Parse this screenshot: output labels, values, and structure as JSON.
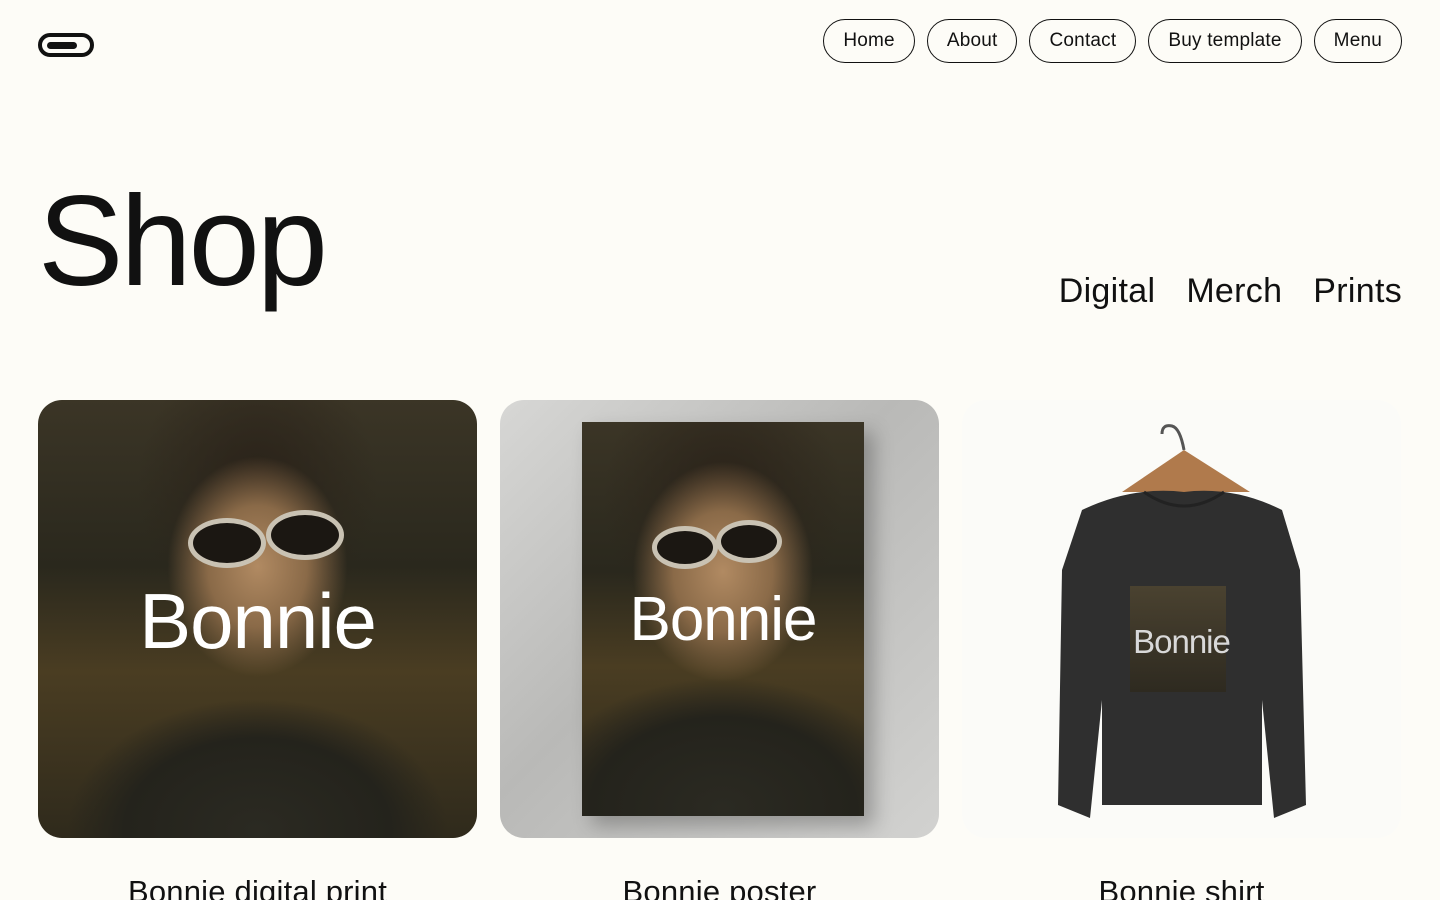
{
  "header": {
    "logo_icon": "pill-logo-icon",
    "nav": [
      {
        "label": "Home"
      },
      {
        "label": "About"
      },
      {
        "label": "Contact"
      },
      {
        "label": "Buy template"
      },
      {
        "label": "Menu"
      }
    ]
  },
  "main": {
    "title": "Shop",
    "filters": [
      {
        "label": "Digital"
      },
      {
        "label": "Merch"
      },
      {
        "label": "Prints"
      }
    ],
    "products": [
      {
        "title": "Bonnie digital print",
        "image_text": "Bonnie"
      },
      {
        "title": "Bonnie poster",
        "image_text": "Bonnie"
      },
      {
        "title": "Bonnie shirt",
        "image_text": "Bonnie"
      }
    ]
  },
  "colors": {
    "background": "#fdfcf7",
    "text": "#111111",
    "shirt": "#2f2f2f"
  }
}
